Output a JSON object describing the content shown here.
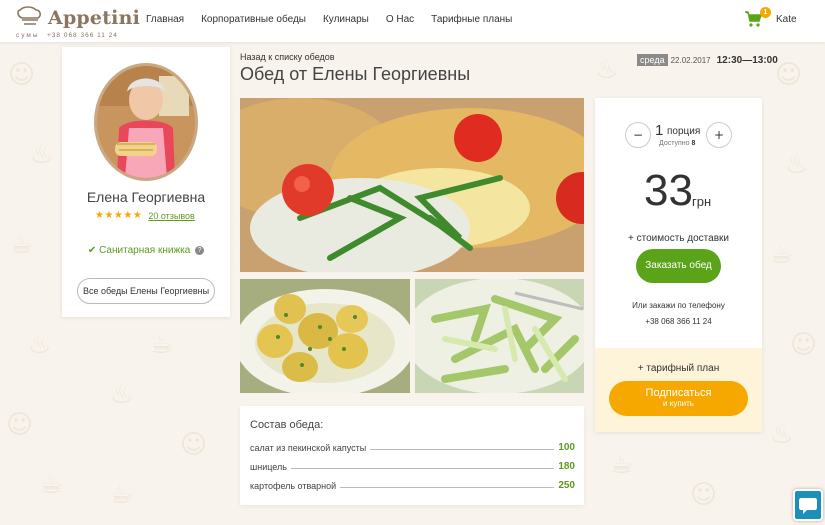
{
  "brand": {
    "name": "Appetini",
    "city": "сумы",
    "phone": "+38 068 366 11 24"
  },
  "nav": {
    "items": [
      "Главная",
      "Корпоративные обеды",
      "Кулинары",
      "О Нас",
      "Тарифные планы"
    ]
  },
  "cart": {
    "count": "1"
  },
  "user": {
    "name": "Kate"
  },
  "chef": {
    "name": "Елена Георгиевна",
    "stars": "★★★★★",
    "reviews": "20 отзывов",
    "sanitary": "Санитарная книжка",
    "all_lunches": "Все обеды Елены Георгиевны"
  },
  "lunch": {
    "back": "Назад к списку обедов",
    "title": "Обед от Елены Георгиевны",
    "day": "среда",
    "date": "22.02.2017",
    "time": "12:30—13:00"
  },
  "composition": {
    "title": "Состав обеда:",
    "items": [
      {
        "name": "салат из пекинской капусты",
        "weight": "100"
      },
      {
        "name": "шницель",
        "weight": "180"
      },
      {
        "name": "картофель отварной",
        "weight": "250"
      }
    ]
  },
  "order": {
    "minus": "−",
    "plus": "+",
    "quantity": "1",
    "unit": "порция",
    "available_label": "Доступно",
    "available_count": "8",
    "price": "33",
    "currency": "грн",
    "delivery": "+ стоимость доставки",
    "order_button": "Заказать обед",
    "call_label": "Или закажи по телефону",
    "call_phone": "+38 068 366 11 24",
    "tariff": "+ тарифный план",
    "subscribe": "Подписаться",
    "subscribe_sub": "и купить"
  },
  "colors": {
    "accent_green": "#5ba318",
    "accent_orange": "#f6a800",
    "brand_brown": "#8a7560",
    "chat_blue": "#1e8fb8"
  },
  "icons": [
    "logo-chef-icon",
    "cart-icon",
    "check-icon",
    "help-icon",
    "chat-icon"
  ]
}
